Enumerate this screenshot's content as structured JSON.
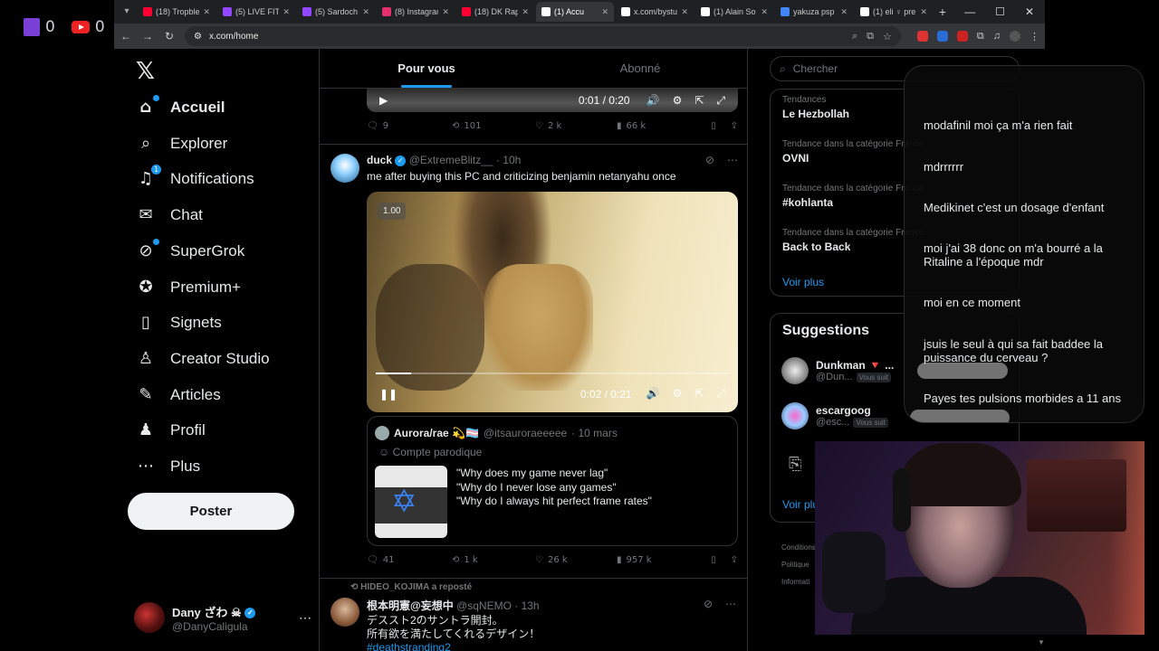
{
  "stream": {
    "twitch_count": "0",
    "youtube_count": "0"
  },
  "browser": {
    "tabs": [
      {
        "label": "(18) Tropble",
        "color": "#ff0033"
      },
      {
        "label": "(5) LIVE FITT",
        "color": "#9146ff"
      },
      {
        "label": "(5) Sardoch",
        "color": "#9146ff"
      },
      {
        "label": "(8) Instagram",
        "color": "#e1306c"
      },
      {
        "label": "(18) DK Rap",
        "color": "#ff0033"
      },
      {
        "label": "(1) Accu",
        "color": "#ffffff"
      },
      {
        "label": "x.com/bystu",
        "color": "#ffffff"
      },
      {
        "label": "(1) Alain So",
        "color": "#ffffff"
      },
      {
        "label": "yakuza psp",
        "color": "#4285f4"
      },
      {
        "label": "(1) eli ♀ pre",
        "color": "#ffffff"
      }
    ],
    "url": "x.com/home"
  },
  "nav": {
    "items": [
      {
        "label": "Accueil",
        "icon": "home-icon",
        "glyph": "⌂"
      },
      {
        "label": "Explorer",
        "icon": "search-icon",
        "glyph": "⌕"
      },
      {
        "label": "Notifications",
        "icon": "bell-icon",
        "glyph": "♫",
        "badge": "1"
      },
      {
        "label": "Chat",
        "icon": "mail-icon",
        "glyph": "✉"
      },
      {
        "label": "SuperGrok",
        "icon": "grok-icon",
        "glyph": "⊘"
      },
      {
        "label": "Premium+",
        "icon": "verified-icon",
        "glyph": "✪"
      },
      {
        "label": "Signets",
        "icon": "bookmark-icon",
        "glyph": "▯"
      },
      {
        "label": "Creator Studio",
        "icon": "creator-icon",
        "glyph": "♙"
      },
      {
        "label": "Articles",
        "icon": "articles-icon",
        "glyph": "✎"
      },
      {
        "label": "Profil",
        "icon": "profile-icon",
        "glyph": "♟"
      },
      {
        "label": "Plus",
        "icon": "more-icon",
        "glyph": "⋯"
      }
    ],
    "post_button": "Poster",
    "account": {
      "name": "Dany ざわ ☠",
      "handle": "@DanyCaligula"
    }
  },
  "feed": {
    "tabs": {
      "for_you": "Pour vous",
      "following": "Abonné"
    },
    "video1": {
      "time": "0:01 / 0:20"
    },
    "post0_stats": {
      "replies": "9",
      "reposts": "101",
      "likes": "2 k",
      "views": "66 k"
    },
    "post1": {
      "name": "duck",
      "handle": "@ExtremeBlitz__",
      "time": "· 10h",
      "text": "me after buying this PC and criticizing benjamin netanyahu once",
      "video": {
        "speed": "1.00",
        "time": "0:02 / 0:21",
        "progress": 0.1
      },
      "quote": {
        "name": "Aurora/rae 💫🏳️‍⚧️",
        "handle": "@itsauroraeeeee",
        "time": "· 10 mars",
        "parody": "Compte parodique",
        "lines": [
          "\"Why does my game never lag\"",
          "\"Why do I never lose any games\"",
          "\"Why do I always hit perfect frame rates\""
        ]
      },
      "stats": {
        "replies": "41",
        "reposts": "1 k",
        "likes": "26 k",
        "views": "957 k"
      }
    },
    "post2": {
      "repost_by": "HIDEO_KOJIMA a reposté",
      "name": "根本明憲@妄想中",
      "handle": "@sqNEMO",
      "time": "· 13h",
      "line1": "デススト2のサントラ開封。",
      "line2": "所有欲を満たしてくれるデザイン！",
      "hashtag": "#deathstranding2"
    }
  },
  "sidebar": {
    "search_placeholder": "Chercher",
    "trends": [
      {
        "context": "Tendances",
        "name": "Le Hezbollah"
      },
      {
        "context": "Tendance dans la catégorie France",
        "name": "OVNI"
      },
      {
        "context": "Tendance dans la catégorie France",
        "name": "#kohlanta"
      },
      {
        "context": "Tendance dans la catégorie France",
        "name": "Back to Back"
      }
    ],
    "see_more": "Voir plus",
    "suggestions_title": "Suggestions",
    "suggestions": [
      {
        "name": "Dunkman 🔻 ...",
        "handle": "@Dun...",
        "follows_you": "Vous suit"
      },
      {
        "name": "escargoog",
        "handle": "@esc...",
        "follows_you": "Vous suit"
      }
    ],
    "see_more2": "Voir plus",
    "footer": [
      "Conditions",
      "Politique",
      "Informati"
    ]
  },
  "chat": {
    "messages": [
      "modafinil moi ça m'a rien fait",
      "mdrrrrrr",
      "Medikinet c'est un dosage d'enfant",
      "moi j'ai 38 donc on m'a bourré a la Ritaline a l'époque mdr",
      "moi en ce moment",
      "jsuis le seul à qui sa fait baddee la puissance du cerveau ?",
      "Payes tes pulsions morbides a 11 ans"
    ]
  }
}
